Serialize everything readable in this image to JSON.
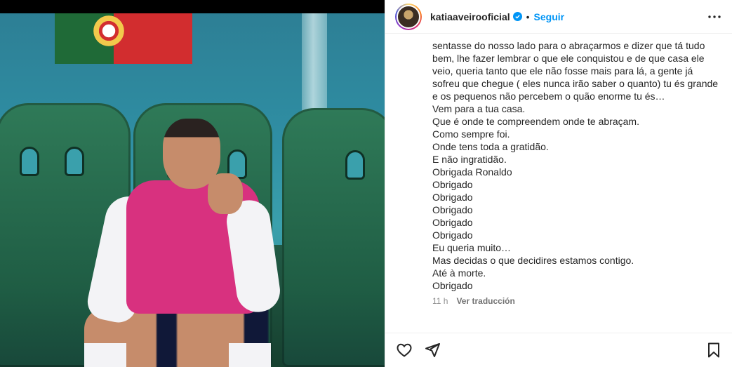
{
  "post": {
    "username": "katiaaveirooficial",
    "follow_label": "Seguir",
    "more_label": "•••",
    "caption_partial_top": "sentasse do nosso lado para o abraçarmos e dizer que tá tudo bem, lhe fazer lembrar o que ele conquistou e de que casa ele veio, queria tanto que ele não fosse mais para lá, a gente já sofreu que chegue ( eles nunca irão saber o quanto) tu és grande e os pequenos não percebem o quão enorme tu és…",
    "caption_lines": [
      "Vem para a tua casa.",
      "Que é onde te compreendem onde te abraçam.",
      "Como sempre foi.",
      "Onde tens toda a gratidão.",
      "E não ingratidão.",
      "Obrigada Ronaldo",
      "Obrigado",
      "Obrigado",
      "Obrigado",
      "Obrigado",
      "Obrigado",
      "Eu queria muito…",
      "Mas decidas o que decidires estamos contigo.",
      "Até à morte.",
      "Obrigado"
    ],
    "timestamp": "11 h",
    "translate_label": "Ver traducción"
  },
  "icons": {
    "verified": "verified-badge-icon",
    "more": "more-options-icon",
    "like": "heart-icon",
    "share": "paper-plane-icon",
    "save": "bookmark-icon"
  },
  "colors": {
    "link_blue": "#0095f6",
    "text": "#262626",
    "muted": "#8e8e8e"
  }
}
